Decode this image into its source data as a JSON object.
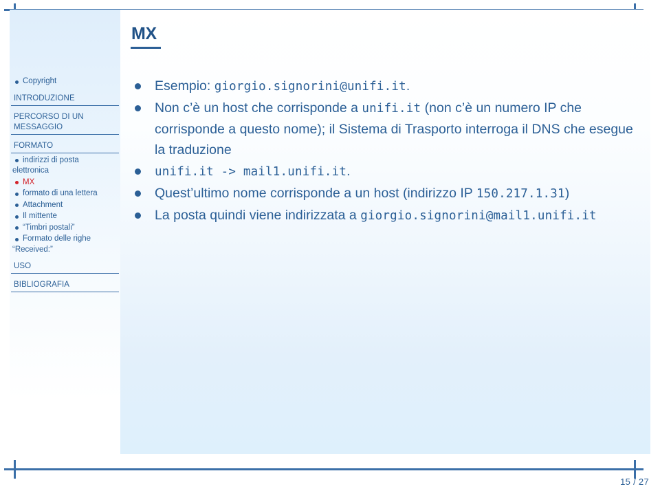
{
  "slide": {
    "title": "MX",
    "page_label": "15 / 27",
    "accent_color": "#2b5f96",
    "active_color": "#d2232a",
    "rule_color": "#3b6fa8"
  },
  "sidebar": {
    "blocks": [
      {
        "kind": "item",
        "name": "copyright",
        "label": "Copyright",
        "active": false
      },
      {
        "kind": "head",
        "name": "introduzione",
        "label": "INTRODUZIONE"
      },
      {
        "kind": "head",
        "name": "percorso-di-un-messaggio",
        "label": "PERCORSO DI UN MESSAGGIO"
      },
      {
        "kind": "head",
        "name": "formato",
        "label": "FORMATO"
      },
      {
        "kind": "item",
        "name": "indirizzi-di-posta-elettronica",
        "label": "indirizzi di posta",
        "label2": "elettronica",
        "active": false
      },
      {
        "kind": "item",
        "name": "mx",
        "label": "MX",
        "active": true
      },
      {
        "kind": "item",
        "name": "formato-di-una-lettera",
        "label": "formato di una lettera",
        "active": false
      },
      {
        "kind": "item",
        "name": "attachment",
        "label": "Attachment",
        "active": false
      },
      {
        "kind": "item",
        "name": "il-mittente",
        "label": "Il mittente",
        "active": false
      },
      {
        "kind": "item",
        "name": "timbri-postali",
        "label": "“Timbri postali”",
        "active": false
      },
      {
        "kind": "item",
        "name": "formato-delle-righe-received",
        "label": "Formato delle righe",
        "label2": "“Received:”",
        "active": false
      },
      {
        "kind": "head",
        "name": "uso",
        "label": "USO"
      },
      {
        "kind": "head",
        "name": "bibliografia",
        "label": "BIBLIOGRAFIA"
      }
    ]
  },
  "content": {
    "bullets": [
      {
        "name": "bullet-esempio",
        "runs": [
          {
            "t": "Esempio: ",
            "mono": false
          },
          {
            "t": "giorgio.signorini@unifi.it",
            "mono": true
          },
          {
            "t": ".",
            "mono": false
          }
        ]
      },
      {
        "name": "bullet-non-ce-un-host",
        "runs": [
          {
            "t": "Non c’è un host che corrisponde a ",
            "mono": false
          },
          {
            "t": "unifi.it",
            "mono": true
          },
          {
            "t": " (non c’è un numero IP che corrisponde a questo nome); il Sistema di Trasporto interroga il DNS che esegue la traduzione",
            "mono": false
          }
        ]
      },
      {
        "name": "bullet-unifi-to-mail1",
        "runs": [
          {
            "t": "unifi.it -> mail1.unifi.it",
            "mono": true
          },
          {
            "t": ".",
            "mono": false
          }
        ]
      },
      {
        "name": "bullet-questultimo-nome",
        "runs": [
          {
            "t": "Quest’ultimo nome corrisponde a un host (indirizzo IP ",
            "mono": false
          },
          {
            "t": "150.217.1.31",
            "mono": true
          },
          {
            "t": ")",
            "mono": false
          }
        ]
      },
      {
        "name": "bullet-la-posta-quindi",
        "runs": [
          {
            "t": "La posta quindi viene indirizzata a ",
            "mono": false
          },
          {
            "t": "giorgio.signorini@mail1.unifi.it",
            "mono": true
          }
        ]
      }
    ]
  }
}
